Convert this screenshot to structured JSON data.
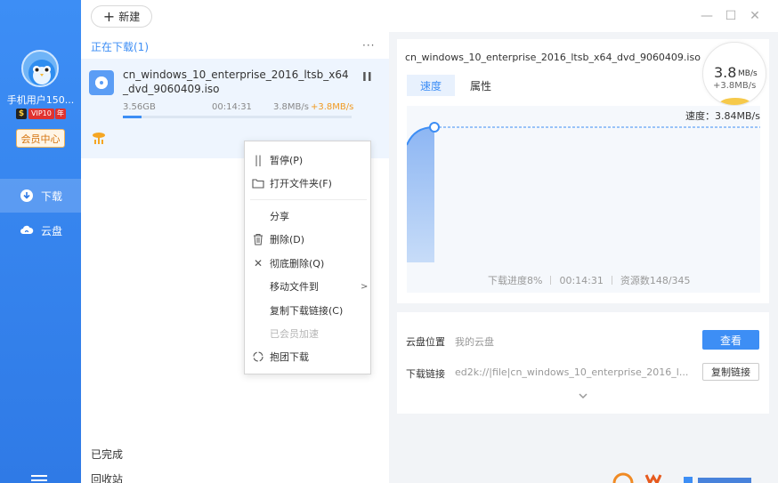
{
  "sidebar": {
    "username": "手机用户150...",
    "vip_label": "VIP10",
    "vip_year": "年",
    "member_center": "会员中心",
    "nav": [
      {
        "label": "下载",
        "icon": "download-icon",
        "active": true
      },
      {
        "label": "云盘",
        "icon": "cloud-icon",
        "active": false
      }
    ]
  },
  "toolbar": {
    "new_label": "新建"
  },
  "list": {
    "section_title": "正在下载(1)",
    "more": "···",
    "task": {
      "name": "cn_windows_10_enterprise_2016_ltsb_x64_dvd_9060409.iso",
      "size": "3.56GB",
      "time_left": "00:14:31",
      "speed": "3.8MB/s",
      "boost": "+3.8MB/s",
      "progress_percent": 8
    },
    "completed": "已完成",
    "recycle": "回收站"
  },
  "context_menu": [
    {
      "label": "暂停(P)",
      "icon": "pause-icon",
      "disabled": false
    },
    {
      "label": "打开文件夹(F)",
      "icon": "folder-icon",
      "disabled": false
    },
    {
      "label": "分享",
      "icon": "",
      "disabled": false
    },
    {
      "label": "删除(D)",
      "icon": "trash-icon",
      "disabled": false
    },
    {
      "label": "彻底删除(Q)",
      "icon": "close-icon",
      "disabled": false
    },
    {
      "label": "移动文件到",
      "icon": "",
      "disabled": false,
      "submenu": true
    },
    {
      "label": "复制下载链接(C)",
      "icon": "",
      "disabled": false
    },
    {
      "label": "已会员加速",
      "icon": "",
      "disabled": true
    },
    {
      "label": "抱团下载",
      "icon": "group-icon",
      "disabled": false
    }
  ],
  "detail": {
    "title": "cn_windows_10_enterprise_2016_ltsb_x64_dvd_9060409.iso",
    "tab_speed": "速度",
    "tab_attr": "属性",
    "speed_value": "3.8",
    "speed_unit": "MB/s",
    "speed_boost": "+3.8MB/s",
    "speed_label": "速度：3.84MB/s",
    "stats": {
      "progress": "下载进度8%",
      "time": "00:14:31",
      "sources": "资源数148/345"
    },
    "cloud_location_label": "云盘位置",
    "cloud_location_value": "我的云盘",
    "view_button": "查看",
    "link_label": "下载链接",
    "link_value": "ed2k://|file|cn_windows_10_enterprise_2016_l...",
    "copy_button": "复制链接"
  },
  "colors": {
    "accent": "#3d8ef5",
    "boost": "#f09a22",
    "sidebar": "#2f7ae6"
  }
}
